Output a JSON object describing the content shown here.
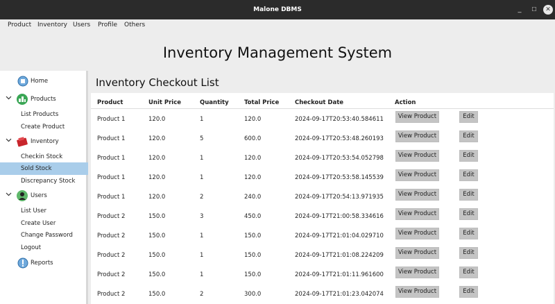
{
  "window": {
    "title": "Malone DBMS",
    "min": "_",
    "max": "☐",
    "close": "✕"
  },
  "menu": [
    "Product",
    "Inventory",
    "Users",
    "Profile",
    "Others"
  ],
  "app_title": "Inventory Management System",
  "sidebar": {
    "home": "Home",
    "products": {
      "label": "Products",
      "items": [
        "List Products",
        "Create Product"
      ]
    },
    "inventory": {
      "label": "Inventory",
      "items": [
        "Checkin Stock",
        "Sold Stock",
        "Discrepancy Stock"
      ],
      "selected": "Sold Stock"
    },
    "users": {
      "label": "Users",
      "items": [
        "List User",
        "Create User",
        "Change Password",
        "Logout"
      ]
    },
    "reports": "Reports"
  },
  "main": {
    "heading": "Inventory Checkout List",
    "columns": [
      "Product",
      "Unit Price",
      "Quantity",
      "Total Price",
      "Checkout Date",
      "Action"
    ],
    "view_label": "View Product",
    "edit_label": "Edit",
    "rows": [
      [
        "Product 1",
        "120.0",
        "1",
        "120.0",
        "2024-09-17T20:53:40.584611"
      ],
      [
        "Product 1",
        "120.0",
        "5",
        "600.0",
        "2024-09-17T20:53:48.260193"
      ],
      [
        "Product 1",
        "120.0",
        "1",
        "120.0",
        "2024-09-17T20:53:54.052798"
      ],
      [
        "Product 1",
        "120.0",
        "1",
        "120.0",
        "2024-09-17T20:53:58.145539"
      ],
      [
        "Product 1",
        "120.0",
        "2",
        "240.0",
        "2024-09-17T20:54:13.971935"
      ],
      [
        "Product 2",
        "150.0",
        "3",
        "450.0",
        "2024-09-17T21:00:58.334616"
      ],
      [
        "Product 2",
        "150.0",
        "1",
        "150.0",
        "2024-09-17T21:01:04.029710"
      ],
      [
        "Product 2",
        "150.0",
        "1",
        "150.0",
        "2024-09-17T21:01:08.224209"
      ],
      [
        "Product 2",
        "150.0",
        "1",
        "150.0",
        "2024-09-17T21:01:11.961600"
      ],
      [
        "Product 2",
        "150.0",
        "2",
        "300.0",
        "2024-09-17T21:01:23.042074"
      ]
    ]
  }
}
